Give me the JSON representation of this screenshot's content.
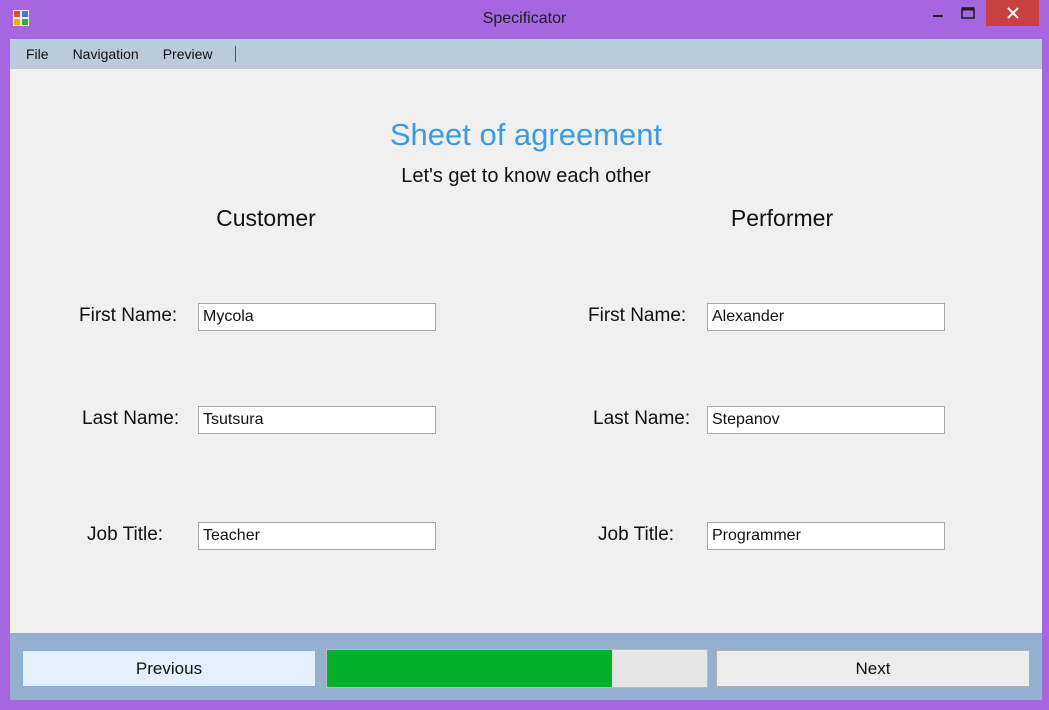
{
  "window": {
    "title": "Specificator"
  },
  "menu": {
    "items": [
      {
        "label": "File"
      },
      {
        "label": "Navigation"
      },
      {
        "label": "Preview"
      }
    ]
  },
  "page": {
    "title": "Sheet of agreement",
    "subtitle": "Let's get to know each other",
    "title_color": "#3b9be3"
  },
  "customer": {
    "heading": "Customer",
    "first_name_label": "First Name:",
    "first_name": "Mycola",
    "last_name_label": "Last Name:",
    "last_name": "Tsutsura",
    "job_title_label": "Job Title:",
    "job_title": "Teacher"
  },
  "performer": {
    "heading": "Performer",
    "first_name_label": "First Name:",
    "first_name": "Alexander",
    "last_name_label": "Last Name:",
    "last_name": "Stepanov",
    "job_title_label": "Job Title:",
    "job_title": "Programmer"
  },
  "footer": {
    "previous_label": "Previous",
    "next_label": "Next",
    "progress_fraction": 0.75,
    "progress_color": "#06b02b"
  },
  "icons": {
    "app": "app-window-icon",
    "minimize": "minimize-icon",
    "maximize": "maximize-icon",
    "close": "close-icon"
  }
}
